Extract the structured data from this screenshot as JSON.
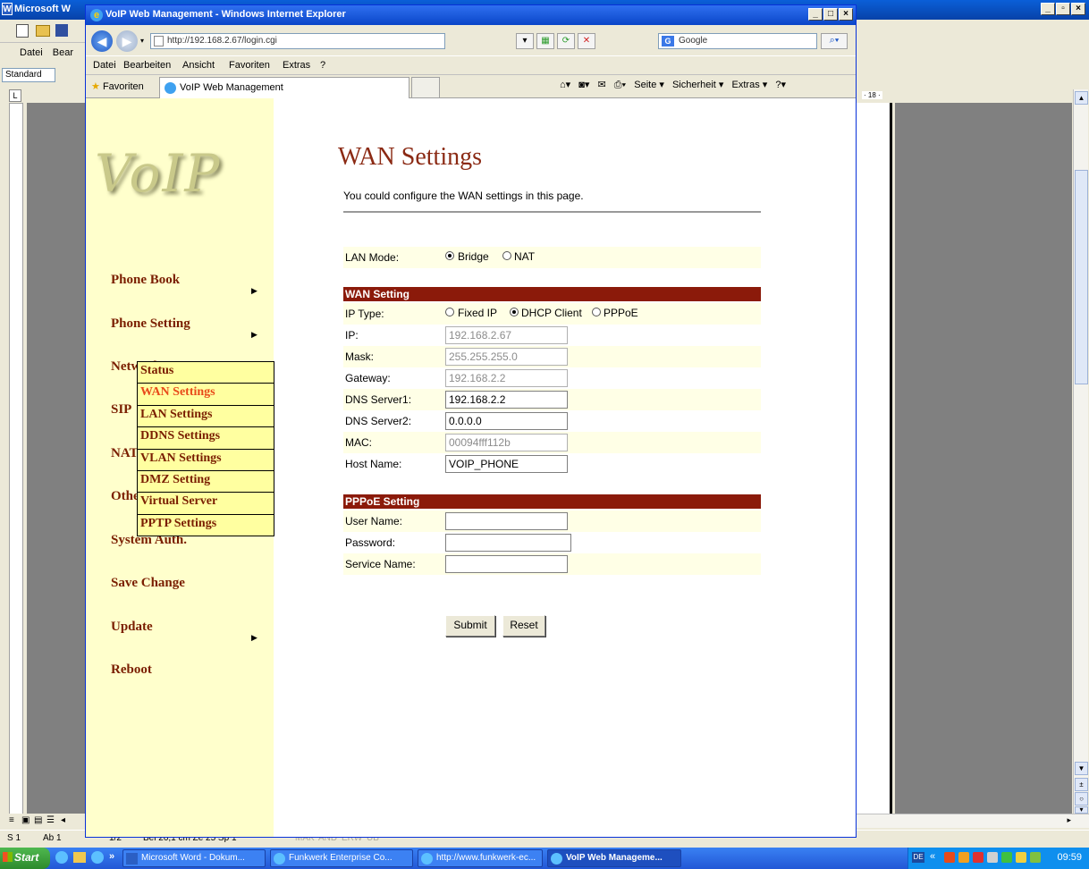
{
  "word": {
    "title": "Microsoft W",
    "menu_file": "Datei",
    "menu_edit": "Bear",
    "style_box": "Standard",
    "ruler_right": "· 18 ·",
    "status": {
      "page": "S 1",
      "section": "Ab 1",
      "pages": "1/2",
      "position": "Bei 26,1 cm Ze 25   Sp 1",
      "mak": "MAK",
      "and": "ÄND",
      "erw": "ERW",
      "ub": "ÜB"
    }
  },
  "ie": {
    "title": "VoIP Web Management - Windows Internet Explorer",
    "url": "http://192.168.2.67/login.cgi",
    "search_placeholder": "Google",
    "menu": [
      "Datei",
      "Bearbeiten",
      "Ansicht",
      "Favoriten",
      "Extras",
      "?"
    ],
    "favorites_label": "Favoriten",
    "tab_title": "VoIP Web Management",
    "cmd": {
      "page": "Seite ▾",
      "security": "Sicherheit ▾",
      "extras": "Extras ▾"
    }
  },
  "sidebar": {
    "logo": "VoIP",
    "items": [
      {
        "label": "Phone Book"
      },
      {
        "label": "Phone Setting"
      },
      {
        "label": "Network"
      },
      {
        "label": "SIP"
      },
      {
        "label": "NAT"
      },
      {
        "label": "Other"
      },
      {
        "label": "System Auth."
      },
      {
        "label": "Save Change"
      },
      {
        "label": "Update"
      },
      {
        "label": "Reboot"
      }
    ],
    "submenu": [
      "Status",
      "WAN Settings",
      "LAN Settings",
      "DDNS Settings",
      "VLAN Settings",
      "DMZ Setting",
      "Virtual Server",
      "PPTP Settings"
    ]
  },
  "main": {
    "title": "WAN Settings",
    "description": "You could configure the WAN settings in this page.",
    "lan_mode": {
      "label": "LAN Mode:",
      "options": [
        "Bridge",
        "NAT"
      ],
      "selected": "Bridge"
    },
    "wan_section": "WAN Setting",
    "ip_type": {
      "label": "IP Type:",
      "options": [
        "Fixed IP",
        "DHCP Client",
        "PPPoE"
      ],
      "selected": "DHCP Client"
    },
    "fields": {
      "ip": {
        "label": "IP:",
        "value": "192.168.2.67"
      },
      "mask": {
        "label": "Mask:",
        "value": "255.255.255.0"
      },
      "gateway": {
        "label": "Gateway:",
        "value": "192.168.2.2"
      },
      "dns1": {
        "label": "DNS Server1:",
        "value": "192.168.2.2"
      },
      "dns2": {
        "label": "DNS Server2:",
        "value": "0.0.0.0"
      },
      "mac": {
        "label": "MAC:",
        "value": "00094fff112b"
      },
      "host": {
        "label": "Host Name:",
        "value": "VOIP_PHONE"
      }
    },
    "pppoe_section": "PPPoE Setting",
    "pppoe": {
      "user": {
        "label": "User Name:",
        "value": ""
      },
      "password": {
        "label": "Password:",
        "value": ""
      },
      "service": {
        "label": "Service Name:",
        "value": ""
      }
    },
    "submit": "Submit",
    "reset": "Reset"
  },
  "taskbar": {
    "start": "Start",
    "items": [
      "Microsoft Word - Dokum...",
      "Funkwerk Enterprise Co...",
      "http://www.funkwerk-ec...",
      "VoIP Web Manageme..."
    ],
    "clock": "09:59",
    "lang": "DE"
  }
}
